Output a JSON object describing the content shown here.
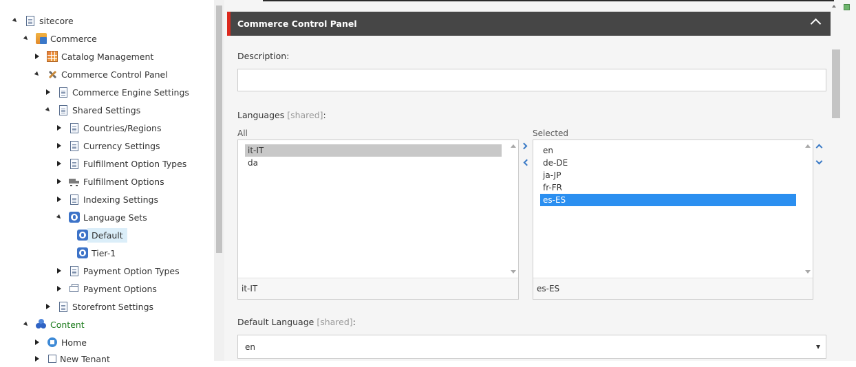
{
  "tree": {
    "items": [
      {
        "label": "sitecore",
        "icon": "document-icon",
        "expanded": true
      },
      {
        "label": "Commerce",
        "icon": "commerce-icon",
        "expanded": true
      },
      {
        "label": "Catalog Management",
        "icon": "catalog-grid-icon",
        "expanded": false
      },
      {
        "label": "Commerce Control Panel",
        "icon": "tools-icon",
        "expanded": true
      },
      {
        "label": "Commerce Engine Settings",
        "icon": "document-icon",
        "expanded": false
      },
      {
        "label": "Shared Settings",
        "icon": "document-icon",
        "expanded": true
      },
      {
        "label": "Countries/Regions",
        "icon": "document-icon",
        "expanded": false
      },
      {
        "label": "Currency Settings",
        "icon": "document-icon",
        "expanded": false
      },
      {
        "label": "Fulfillment Option Types",
        "icon": "document-icon",
        "expanded": false
      },
      {
        "label": "Fulfillment Options",
        "icon": "truck-icon",
        "expanded": false
      },
      {
        "label": "Indexing Settings",
        "icon": "document-icon",
        "expanded": false
      },
      {
        "label": "Language Sets",
        "icon": "globe-icon",
        "expanded": true
      },
      {
        "label": "Default",
        "icon": "globe-icon",
        "selected": true
      },
      {
        "label": "Tier-1",
        "icon": "globe-icon"
      },
      {
        "label": "Payment Option Types",
        "icon": "document-icon",
        "expanded": false
      },
      {
        "label": "Payment Options",
        "icon": "payment-card-icon",
        "expanded": false
      },
      {
        "label": "Storefront Settings",
        "icon": "document-icon",
        "expanded": false
      },
      {
        "label": "Content",
        "icon": "content-icon",
        "expanded": true
      },
      {
        "label": "Home",
        "icon": "home-icon",
        "expanded": false
      },
      {
        "label": "New Tenant",
        "icon": "tenant-icon",
        "expanded": false
      }
    ]
  },
  "section": {
    "title": "Commerce Control Panel"
  },
  "fields": {
    "description": {
      "label": "Description:",
      "value": ""
    },
    "languages": {
      "label": "Languages",
      "shared_tag": "[shared]",
      "suffix": ":",
      "all_caption": "All",
      "selected_caption": "Selected",
      "all_options": [
        "it-IT",
        "da"
      ],
      "all_highlighted": "it-IT",
      "all_footer": "it-IT",
      "selected_options": [
        "en",
        "de-DE",
        "ja-JP",
        "fr-FR",
        "es-ES"
      ],
      "selected_highlighted": "es-ES",
      "selected_footer": "es-ES"
    },
    "default_language": {
      "label": "Default Language",
      "shared_tag": "[shared]",
      "suffix": ":",
      "value": "en"
    }
  },
  "colors": {
    "header_bg": "#464646",
    "header_accent": "#dc291e",
    "selection_blue": "#2b8ff0",
    "chevron_blue": "#3a7ac6",
    "tree_selected_bg": "#dbeef9",
    "content_green": "#1a7a1a"
  }
}
